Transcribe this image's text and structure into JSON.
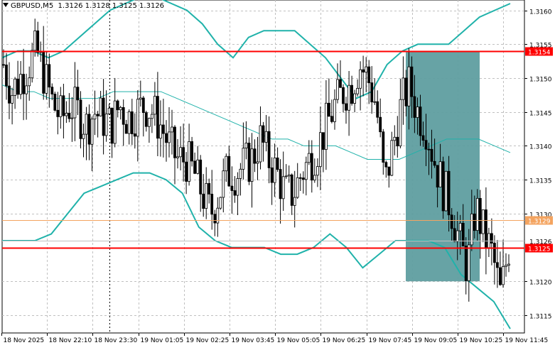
{
  "header": {
    "symbol": "GBPUSD,M5",
    "ohlc": "1.3126 1.3128 1.3125 1.3126"
  },
  "colors": {
    "background": "#ffffff",
    "grid": "#c0c0c0",
    "candle": "#000000",
    "bollinger": "#20b2aa",
    "level_line": "#ff0000",
    "current_price_line": "#f4a460",
    "bid_line": "#c0c0c0",
    "zone": "#5f9ea0",
    "tag_text": "#ffffff"
  },
  "chart_data": {
    "type": "candlestick",
    "ylim": [
      1.311,
      1.3161
    ],
    "y_ticks": [
      "1.3160",
      "1.3155",
      "1.3150",
      "1.3145",
      "1.3140",
      "1.3135",
      "1.3130",
      "1.3120",
      "1.3115"
    ],
    "x_ticks": [
      "18 Nov 2025",
      "18 Nov 22:10",
      "18 Nov 23:30",
      "19 Nov 01:05",
      "19 Nov 02:25",
      "19 Nov 03:45",
      "19 Nov 05:05",
      "19 Nov 06:25",
      "19 Nov 07:45",
      "19 Nov 09:05",
      "19 Nov 10:25",
      "19 Nov 11:45"
    ],
    "close_anchors": [
      1.3152,
      1.3148,
      1.315,
      1.3152,
      1.3154,
      1.315,
      1.3146,
      1.3144,
      1.3146,
      1.3145,
      1.3143,
      1.3145,
      1.3144,
      1.3143,
      1.3146,
      1.3144,
      1.3145,
      1.3146,
      1.3145,
      1.3143,
      1.314,
      1.3138,
      1.3138,
      1.3136,
      1.3133,
      1.313,
      1.3133,
      1.3136,
      1.3136,
      1.3137,
      1.3138,
      1.3141,
      1.3138,
      1.3136,
      1.3133,
      1.3133,
      1.3136,
      1.3138,
      1.314,
      1.3143,
      1.3146,
      1.3148,
      1.3149,
      1.3152,
      1.315,
      1.3146,
      1.3134,
      1.314,
      1.3146,
      1.3149,
      1.3145,
      1.3143,
      1.3138,
      1.3134,
      1.3131,
      1.3126,
      1.3122,
      1.3131,
      1.3127,
      1.3124,
      1.3118,
      1.3125
    ],
    "horizontal_levels": [
      {
        "price": 1.3154,
        "label": "1.3154",
        "kind": "level"
      },
      {
        "price": 1.3129,
        "label": "1.3129",
        "kind": "current"
      },
      {
        "price": 1.3125,
        "label": "1.3125",
        "kind": "level"
      }
    ],
    "bid_label": "1.3126",
    "zone": {
      "price_high": 1.3154,
      "price_low": 1.312
    },
    "upper_band": [
      1.3153,
      1.3154,
      1.3154,
      1.3153,
      1.3154,
      1.3156,
      1.3158,
      1.316,
      1.3161,
      1.3162,
      1.3162,
      1.3161,
      1.316,
      1.3158,
      1.3155,
      1.3153,
      1.3156,
      1.3157,
      1.3157,
      1.3157,
      1.3155,
      1.3153,
      1.315,
      1.3147,
      1.3148,
      1.3152,
      1.3154,
      1.3155,
      1.3155,
      1.3155,
      1.3157,
      1.3159,
      1.316,
      1.3161
    ],
    "middle_band": [
      1.3149,
      1.3148,
      1.3148,
      1.3147,
      1.3147,
      1.3147,
      1.3147,
      1.3148,
      1.3148,
      1.3148,
      1.3148,
      1.3147,
      1.3146,
      1.3145,
      1.3144,
      1.3143,
      1.3142,
      1.3141,
      1.3141,
      1.314,
      1.314,
      1.314,
      1.3139,
      1.3138,
      1.3138,
      1.3138,
      1.3139,
      1.314,
      1.3141,
      1.3141,
      1.3141,
      1.314,
      1.3139
    ],
    "lower_band": [
      1.3126,
      1.3126,
      1.3126,
      1.3127,
      1.313,
      1.3133,
      1.3134,
      1.3135,
      1.3136,
      1.3136,
      1.3135,
      1.3133,
      1.3128,
      1.3126,
      1.3125,
      1.3125,
      1.3125,
      1.3124,
      1.3124,
      1.3125,
      1.3127,
      1.3125,
      1.3122,
      1.3124,
      1.3126,
      1.3126,
      1.3126,
      1.3125,
      1.3121,
      1.3119,
      1.3117,
      1.3113
    ],
    "vertical_marker_tick": 2,
    "grid": true
  }
}
